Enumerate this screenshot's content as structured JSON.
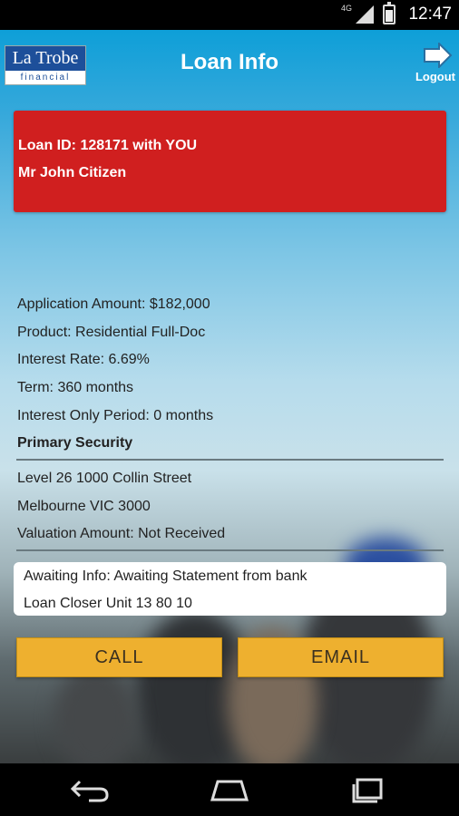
{
  "status_bar": {
    "time": "12:47",
    "network": "4G"
  },
  "header": {
    "logo_top": "La Trobe",
    "logo_bottom": "financial",
    "title": "Loan Info",
    "logout_label": "Logout"
  },
  "loan": {
    "line1": "Loan ID: 128171 with YOU",
    "line2": "Mr John Citizen"
  },
  "details": {
    "application_amount": "Application Amount: $182,000",
    "product": "Product: Residential Full-Doc",
    "interest_rate": "Interest Rate: 6.69%",
    "term": "Term: 360 months",
    "interest_only": "Interest Only Period: 0 months",
    "primary_security_heading": "Primary Security",
    "address_line1": "Level 26 1000 Collin Street",
    "address_line2": "Melbourne VIC 3000",
    "valuation": "Valuation Amount: Not Received"
  },
  "note": {
    "line1": "Awaiting Info: Awaiting Statement from bank",
    "line2": "Loan Closer Unit 13 80 10"
  },
  "actions": {
    "call_label": "CALL",
    "email_label": "EMAIL"
  },
  "colors": {
    "header_blue": "#0e9fd8",
    "loan_card_red": "#d01f1f",
    "button_gold": "#eeb02f"
  },
  "icons": {
    "logout": "logout-arrow-icon",
    "nav_back": "back-icon",
    "nav_home": "home-icon",
    "nav_recents": "recents-icon"
  }
}
